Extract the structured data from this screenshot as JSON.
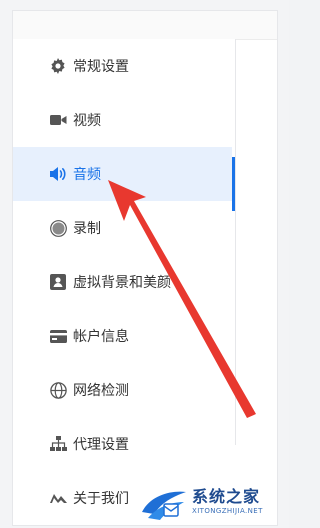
{
  "settings": {
    "menu": [
      {
        "key": "general",
        "label": "常规设置",
        "icon": "gear-icon"
      },
      {
        "key": "video",
        "label": "视频",
        "icon": "video-camera-icon"
      },
      {
        "key": "audio",
        "label": "音频",
        "icon": "speaker-icon",
        "active": true
      },
      {
        "key": "record",
        "label": "录制",
        "icon": "record-icon"
      },
      {
        "key": "virtual-bg",
        "label": "虚拟背景和美颜",
        "icon": "portrait-icon"
      },
      {
        "key": "account",
        "label": "帐户信息",
        "icon": "card-icon"
      },
      {
        "key": "network",
        "label": "网络检测",
        "icon": "globe-icon"
      },
      {
        "key": "proxy",
        "label": "代理设置",
        "icon": "network-tree-icon"
      },
      {
        "key": "about",
        "label": "关于我们",
        "icon": "logo-icon"
      }
    ]
  },
  "colors": {
    "accent": "#1a73e8",
    "active_bg": "#e7f0fd",
    "icon": "#555555",
    "annotation_arrow": "#e8382f"
  },
  "watermark": {
    "main": "系统之家",
    "sub": "XITONGZHIJIA.NET"
  }
}
